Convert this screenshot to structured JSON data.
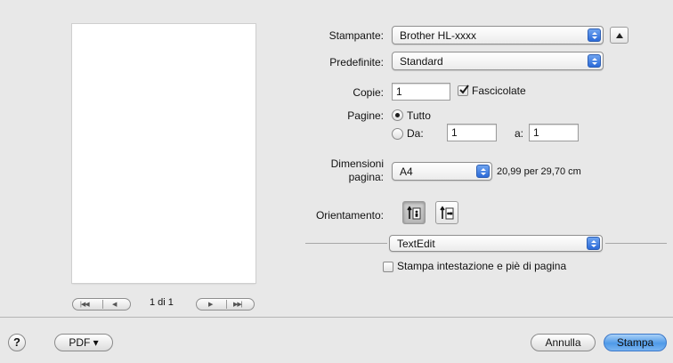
{
  "preview": {
    "page_indicator": "1 di 1"
  },
  "printer": {
    "label": "Stampante:",
    "value": "Brother HL-xxxx"
  },
  "presets": {
    "label": "Predefinite:",
    "value": "Standard"
  },
  "copies": {
    "label": "Copie:",
    "value": "1",
    "collate_label": "Fascicolate",
    "collate_checked": true
  },
  "pages": {
    "label": "Pagine:",
    "all_label": "Tutto",
    "from_label": "Da:",
    "from_value": "1",
    "to_label": "a:",
    "to_value": "1",
    "selected": "all"
  },
  "paper_size": {
    "label_line1": "Dimensioni",
    "label_line2": "pagina:",
    "value": "A4",
    "dimensions": "20,99 per 29,70 cm"
  },
  "orientation": {
    "label": "Orientamento:",
    "selected": "portrait"
  },
  "app_section": {
    "value": "TextEdit",
    "header_footer_label": "Stampa intestazione e piè di pagina",
    "header_footer_checked": false
  },
  "footer": {
    "help_symbol": "?",
    "pdf_label": "PDF ▾",
    "cancel_label": "Annulla",
    "print_label": "Stampa"
  },
  "colors": {
    "background": "#e8e8e8",
    "accent": "#4f9ae8"
  }
}
